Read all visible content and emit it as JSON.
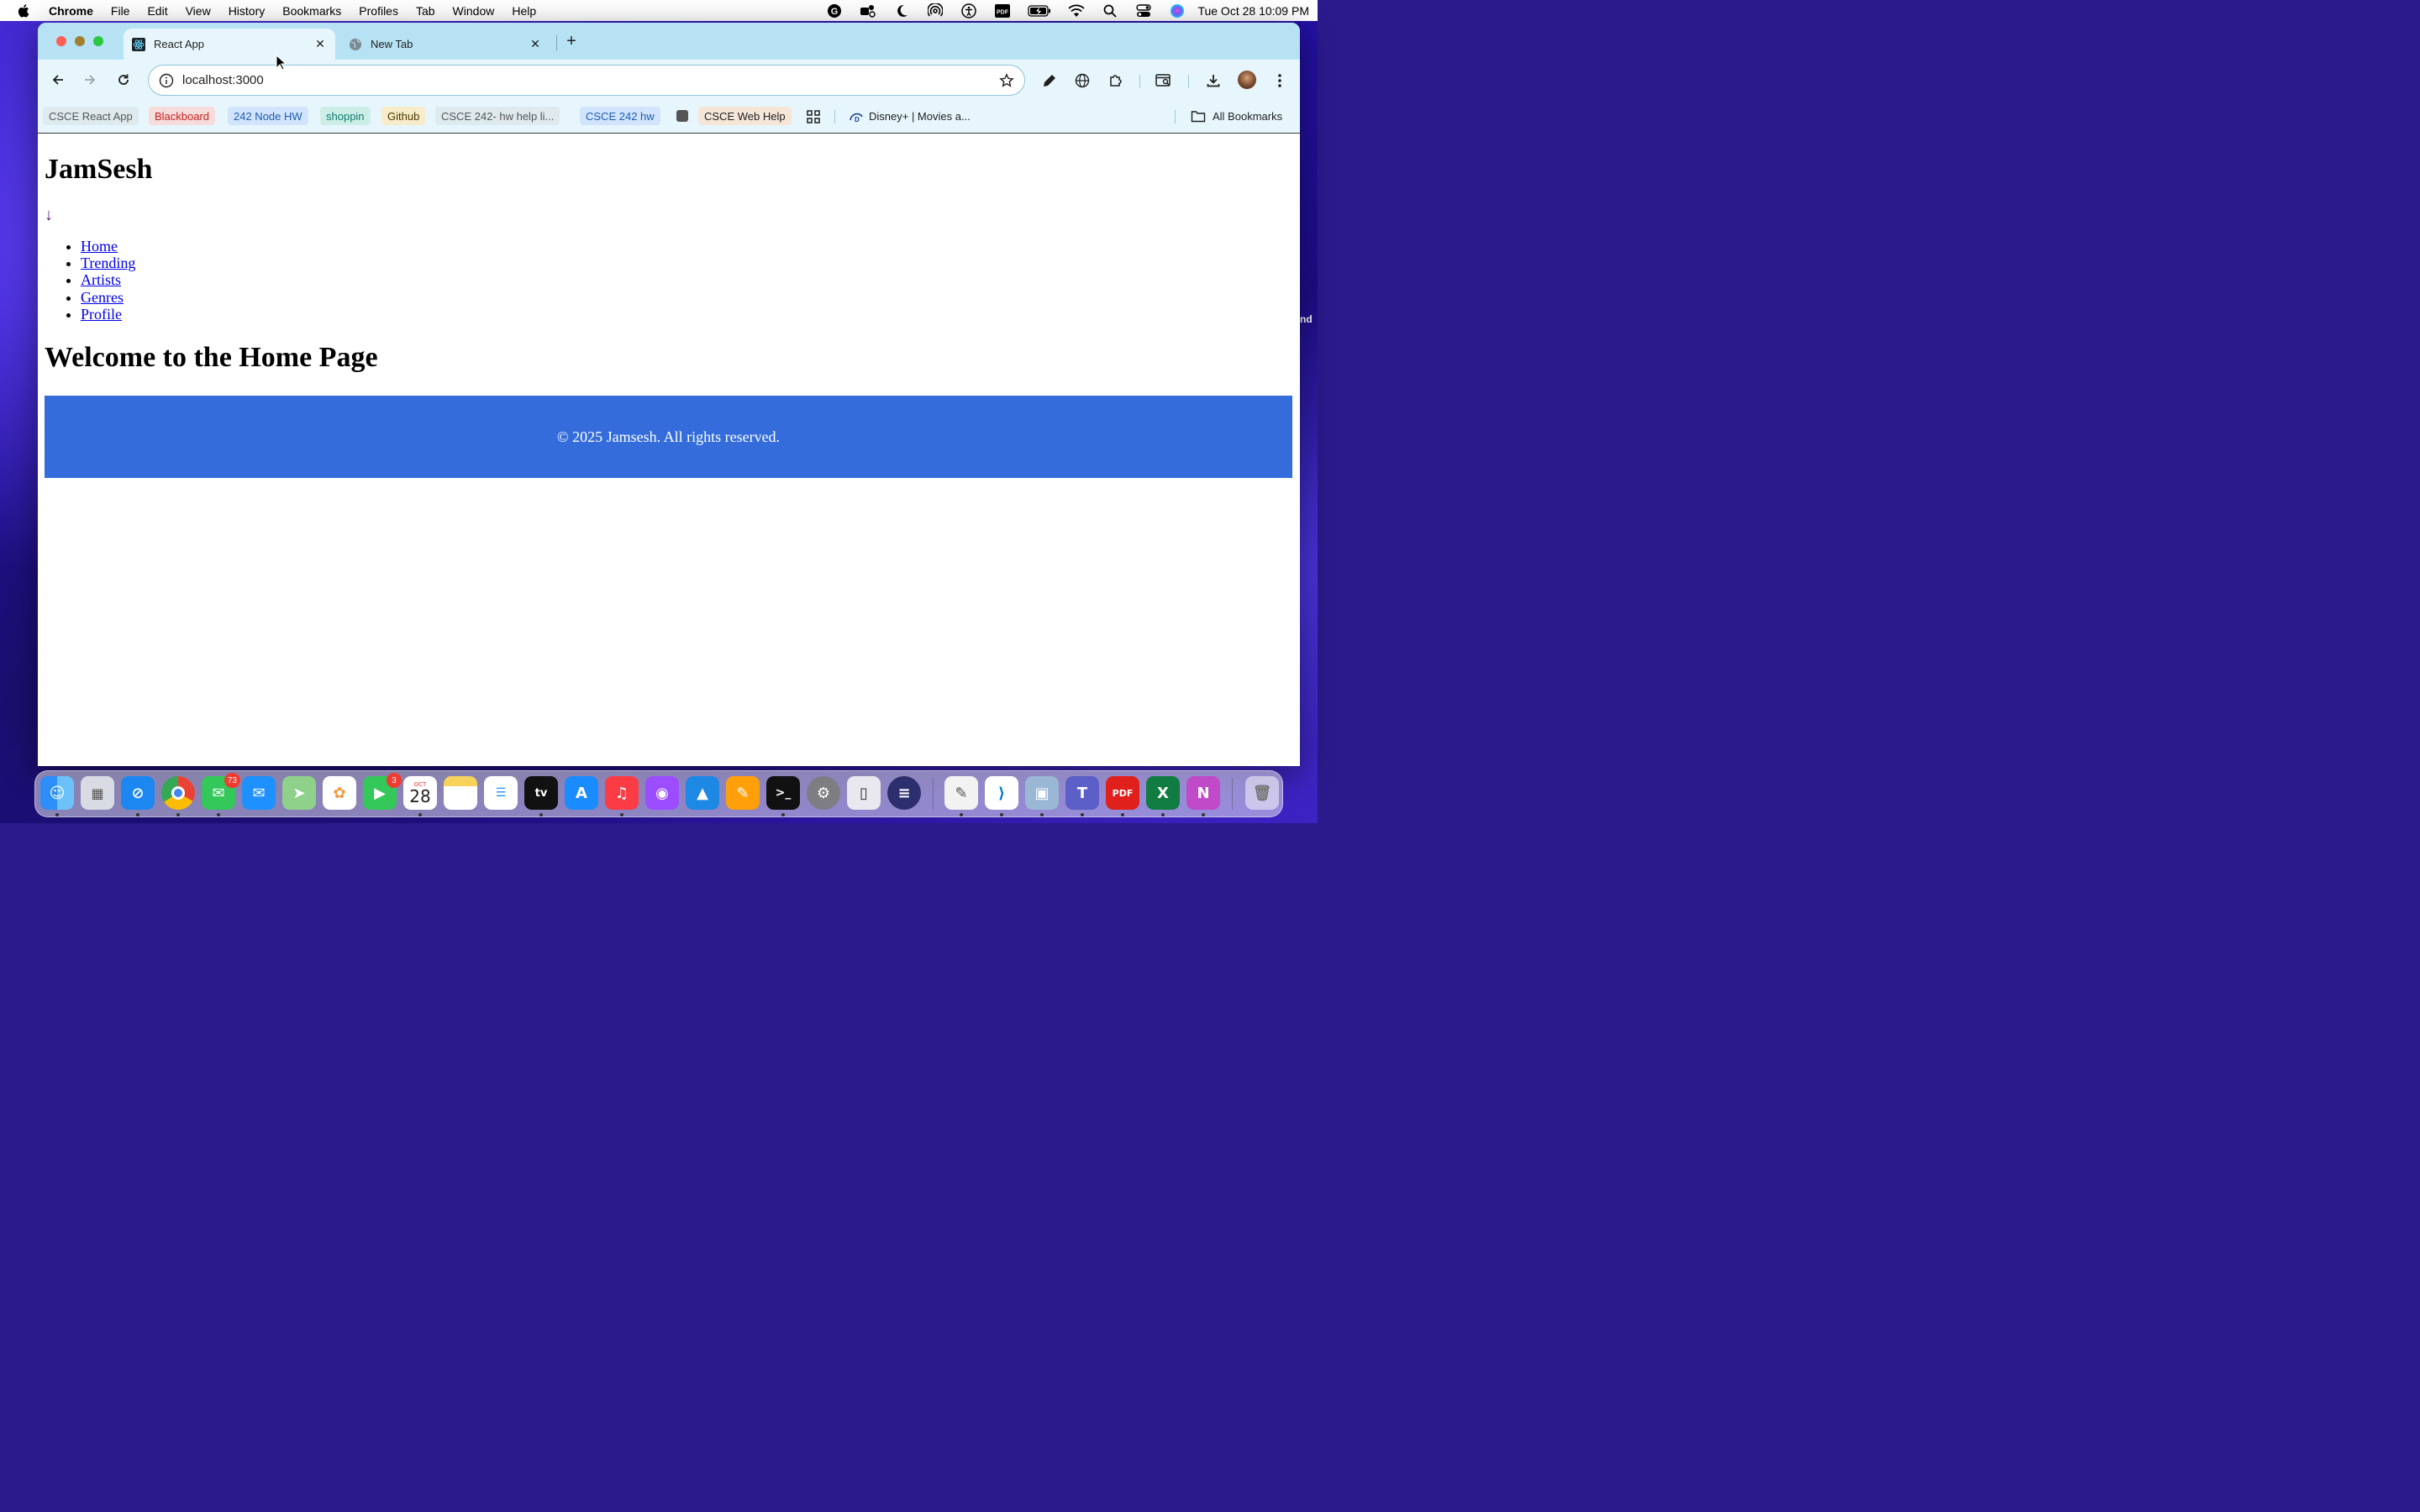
{
  "menubar": {
    "app_name": "Chrome",
    "items": [
      "File",
      "Edit",
      "View",
      "History",
      "Bookmarks",
      "Profiles",
      "Tab",
      "Window",
      "Help"
    ],
    "clock": "Tue Oct 28  10:09 PM",
    "status_icons": [
      "grammarly-icon",
      "teams-status-icon",
      "moon-icon",
      "airdrop-icon",
      "accessibility-icon",
      "pdf-icon",
      "battery-icon",
      "wifi-icon",
      "spotlight-search-icon",
      "control-center-icon",
      "siri-icon"
    ]
  },
  "browser": {
    "tabs": [
      {
        "title": "React App",
        "favicon": "react-icon",
        "active": true
      },
      {
        "title": "New Tab",
        "favicon": "globe-icon",
        "active": false
      }
    ],
    "address": "localhost:3000",
    "bookmarks": [
      {
        "label": "CSCE React App",
        "color": "#555555",
        "bg": "#dfeaee"
      },
      {
        "label": "Blackboard",
        "color": "#c5221f",
        "bg": "#f7dcdc"
      },
      {
        "label": "242 Node HW",
        "color": "#1a5fb4",
        "bg": "#d2e3fc"
      },
      {
        "label": "shoppin",
        "color": "#0f7c6b",
        "bg": "#cdeee8"
      },
      {
        "label": "Github",
        "color": "#4d3a00",
        "bg": "#f6ecc9"
      },
      {
        "label": "CSCE 242- hw help li...",
        "color": "#555555",
        "bg": "#dfeaee"
      },
      {
        "label": "CSCE 242 hw",
        "color": "#1a5fb4",
        "bg": "#d2e3fc"
      },
      {
        "label": "CSCE Web Help",
        "color": "#202124",
        "bg": "#f6e6d8"
      },
      {
        "label": "Disney+ | Movies a...",
        "color": "#202124",
        "bg": "transparent"
      }
    ],
    "all_bookmarks": "All Bookmarks"
  },
  "page": {
    "site_title": "JamSesh",
    "arrow": "↓",
    "nav": [
      "Home",
      "Trending",
      "Artists",
      "Genres",
      "Profile"
    ],
    "heading": "Welcome to the Home Page",
    "footer": "© 2025 Jamsesh. All rights reserved.",
    "footer_color": "#346ddb"
  },
  "dock": {
    "messages_badge": "73",
    "facetime_badge": "3",
    "calendar_month": "OCT",
    "calendar_day": "28"
  },
  "edge_fragment": "nd"
}
